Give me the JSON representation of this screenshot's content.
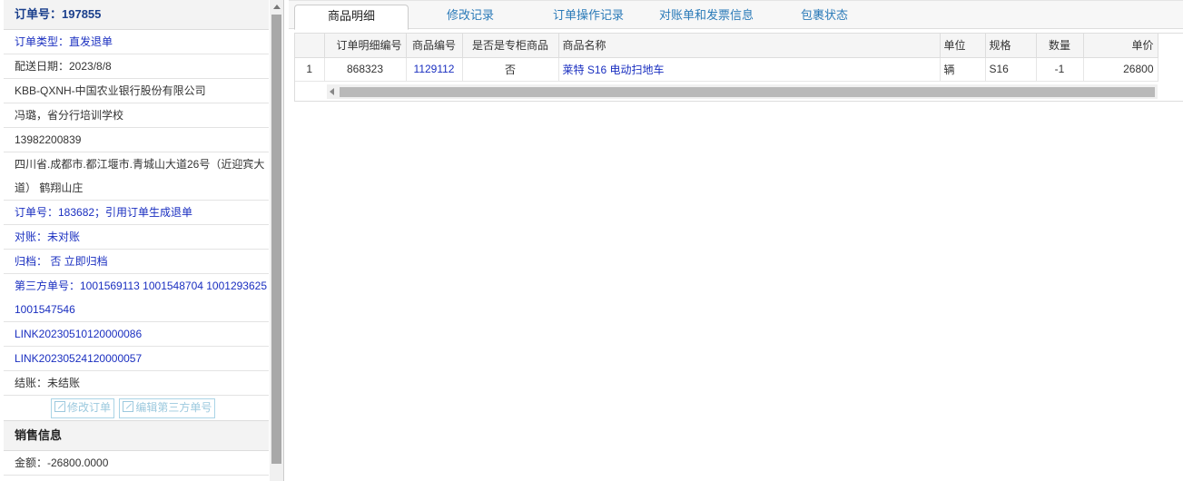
{
  "order": {
    "title": "订单号：197855",
    "fields": [
      {
        "text": "订单类型：直发退单",
        "blue": true
      },
      {
        "text": "配送日期：2023/8/8",
        "blue": false
      },
      {
        "text": "KBB-QXNH-中国农业银行股份有限公司",
        "blue": false
      },
      {
        "text": "冯璐，省分行培训学校",
        "blue": false
      },
      {
        "text": "13982200839",
        "blue": false
      },
      {
        "text": "四川省.成都市.都江堰市.青城山大道26号（近迎宾大道） 鹤翔山庄",
        "blue": false
      },
      {
        "text": "订单号：183682；引用订单生成退单",
        "blue": true
      },
      {
        "text": "对账：未对账",
        "blue": true
      },
      {
        "text": "归档： 否 立即归档",
        "blue": true
      },
      {
        "text": "第三方单号：1001569113 1001548704 1001293625 1001547546",
        "blue": true
      },
      {
        "text": "LINK20230510120000086",
        "blue": true
      },
      {
        "text": "LINK20230524120000057",
        "blue": true
      },
      {
        "text": "结账：未结账",
        "blue": false
      }
    ],
    "buttons": {
      "modify_order": "修改订单",
      "edit_third_party": "编辑第三方单号"
    }
  },
  "sales": {
    "title": "销售信息",
    "amount": "金额：-26800.0000"
  },
  "tabs": [
    "商品明细",
    "修改记录",
    "订单操作记录",
    "对账单和发票信息",
    "包裹状态"
  ],
  "grid": {
    "headers": [
      "",
      "订单明细编号",
      "商品编号",
      "是否是专柜商品",
      "商品名称",
      "单位",
      "规格",
      "数量",
      "单价"
    ],
    "rows": [
      [
        "1",
        "868323",
        "1129112",
        "否",
        "莱特 S16 电动扫地车",
        "辆",
        "S16",
        "-1",
        "26800"
      ]
    ]
  },
  "icons": {
    "edit": "edit-icon",
    "scroll_up": "arrow-up-icon",
    "scroll_left": "arrow-left-icon"
  }
}
